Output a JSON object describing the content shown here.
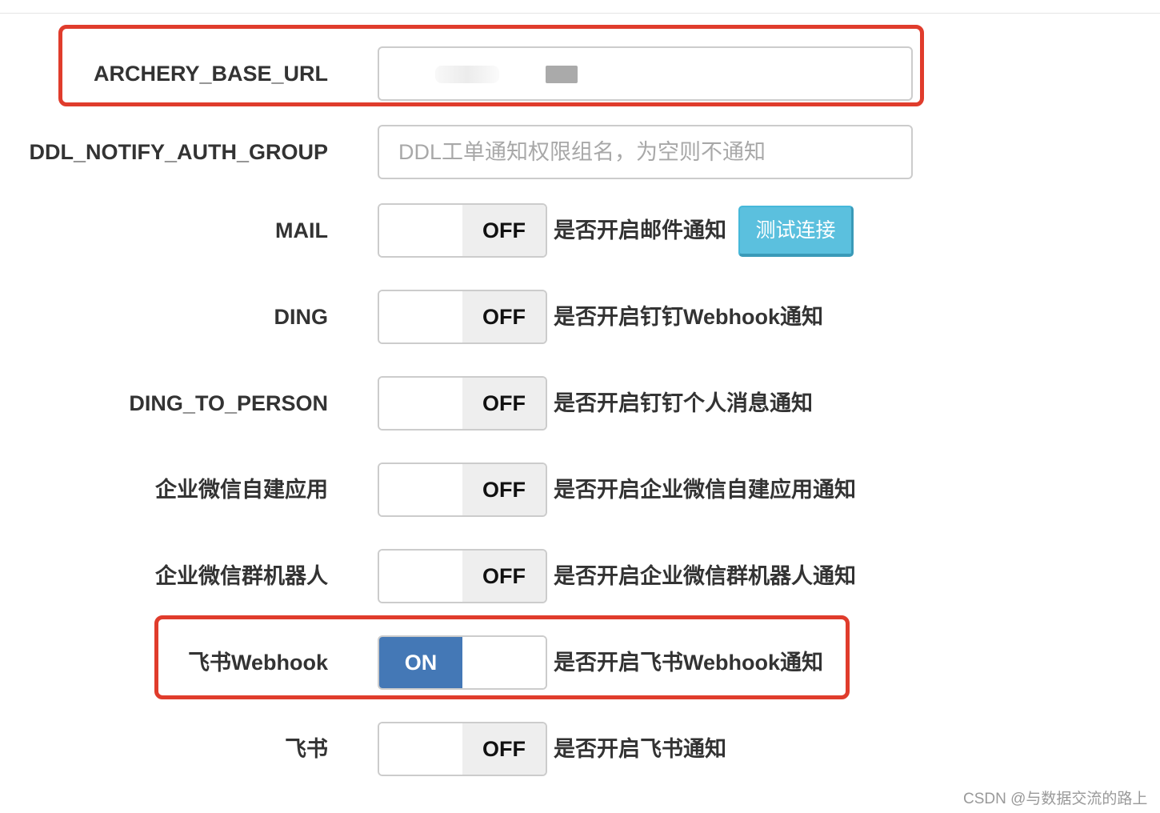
{
  "settings": [
    {
      "label": "ARCHERY_BASE_URL",
      "type": "text",
      "value": "",
      "placeholder": ""
    },
    {
      "label": "DDL_NOTIFY_AUTH_GROUP",
      "type": "text",
      "value": "",
      "placeholder": "DDL工单通知权限组名，为空则不通知"
    },
    {
      "label": "MAIL",
      "type": "switch",
      "state": "OFF",
      "description": "是否开启邮件通知",
      "button": "测试连接"
    },
    {
      "label": "DING",
      "type": "switch",
      "state": "OFF",
      "description": "是否开启钉钉Webhook通知"
    },
    {
      "label": "DING_TO_PERSON",
      "type": "switch",
      "state": "OFF",
      "description": "是否开启钉钉个人消息通知"
    },
    {
      "label": "企业微信自建应用",
      "type": "switch",
      "state": "OFF",
      "description": "是否开启企业微信自建应用通知"
    },
    {
      "label": "企业微信群机器人",
      "type": "switch",
      "state": "OFF",
      "description": "是否开启企业微信群机器人通知"
    },
    {
      "label": "飞书Webhook",
      "type": "switch",
      "state": "ON",
      "description": "是否开启飞书Webhook通知"
    },
    {
      "label": "飞书",
      "type": "switch",
      "state": "OFF",
      "description": "是否开启飞书通知"
    }
  ],
  "watermark": "CSDN @与数据交流的路上",
  "colors": {
    "highlight": "#e03c2c",
    "switch_on": "#4478b6",
    "switch_off": "#eeeeee",
    "test_button": "#5bc0de"
  }
}
